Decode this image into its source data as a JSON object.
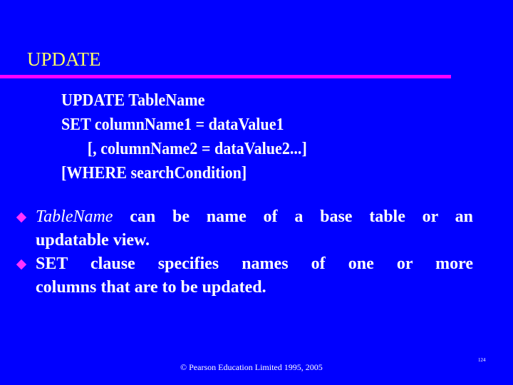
{
  "slide": {
    "title": "UPDATE",
    "syntax": [
      "UPDATE TableName",
      "SET columnName1 = dataValue1",
      "[, columnName2 = dataValue2...]",
      "[WHERE searchCondition]"
    ],
    "bullets": [
      {
        "italic_lead": "TableName",
        "line1_rest": " can be name of a base table or an",
        "line2": "updatable view."
      },
      {
        "italic_lead": "",
        "line1_rest": "SET clause specifies names of one or more",
        "line2": "columns that are to be updated."
      }
    ],
    "footer": "© Pearson Education Limited 1995, 2005",
    "page_number": "124"
  },
  "colors": {
    "background": "#0000ff",
    "title": "#ffff66",
    "rule": "#ff00ff",
    "bullet": "#ff33ff",
    "text": "#ffffff"
  }
}
